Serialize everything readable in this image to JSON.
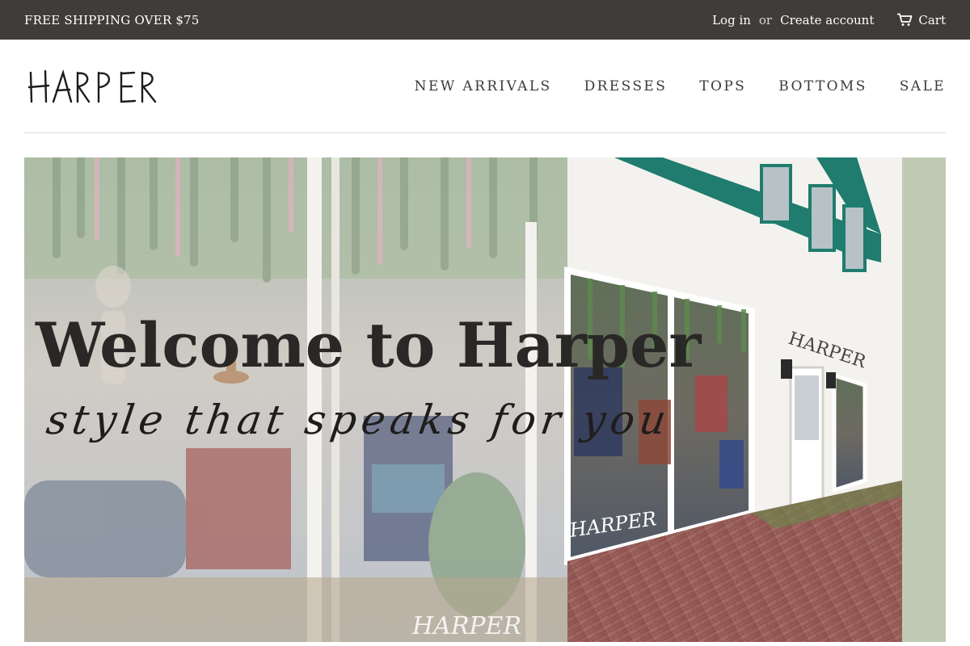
{
  "topbar": {
    "shipping_text": "FREE SHIPPING OVER $75",
    "login_label": "Log in",
    "or_text": "or",
    "create_account_label": "Create account",
    "cart_label": "Cart",
    "cart_icon": "cart-icon"
  },
  "header": {
    "logo_text": "HARPER",
    "nav": [
      {
        "label": "NEW ARRIVALS"
      },
      {
        "label": "DRESSES"
      },
      {
        "label": "TOPS"
      },
      {
        "label": "BOTTOMS"
      },
      {
        "label": "SALE"
      }
    ]
  },
  "hero": {
    "title": "Welcome to Harper",
    "tagline": "style that speaks for you",
    "storefront_sign": "HARPER",
    "window_sign": "HARPER"
  },
  "colors": {
    "topbar_bg": "#403c3a",
    "text": "#3d3a37",
    "awning_green": "#1f7c6e",
    "brick": "#9a5a55"
  }
}
